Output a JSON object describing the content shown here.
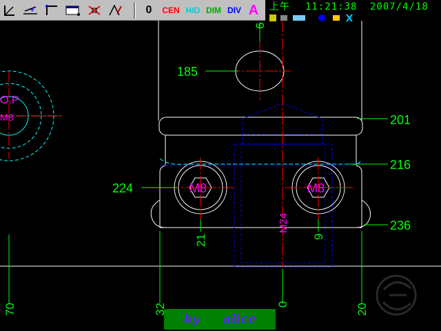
{
  "toolbar": {
    "btn_zero": "0",
    "btn_cen": "CEN",
    "btn_hid": "HID",
    "btn_dim": "DIM",
    "btn_div": "DIV",
    "btn_text": "A"
  },
  "clock": {
    "ampm": "上午",
    "time": "11:21:38",
    "date": "2007/4/18"
  },
  "drawing": {
    "callouts": {
      "c185": "185",
      "c201": "201",
      "c216": "216",
      "c224": "224",
      "c236": "236",
      "c21": "21",
      "c9": "9",
      "c6": "6"
    },
    "bottom_labels": {
      "b70": "70",
      "b32": "32",
      "b0": "0",
      "b20": "20"
    },
    "thread_labels": {
      "m8_left": "M8",
      "m8_right": "M8",
      "m8_far": "M8",
      "m24": "M24",
      "op": "O.P"
    }
  },
  "signature": {
    "text": "by alice"
  },
  "colors": {
    "background": "#000000",
    "outline": "#ffffff",
    "centerline": "#ff0000",
    "hidden": "#0000ff",
    "dimension": "#00ff00",
    "thread_text": "#ff00ff",
    "cyan": "#00ffff"
  }
}
